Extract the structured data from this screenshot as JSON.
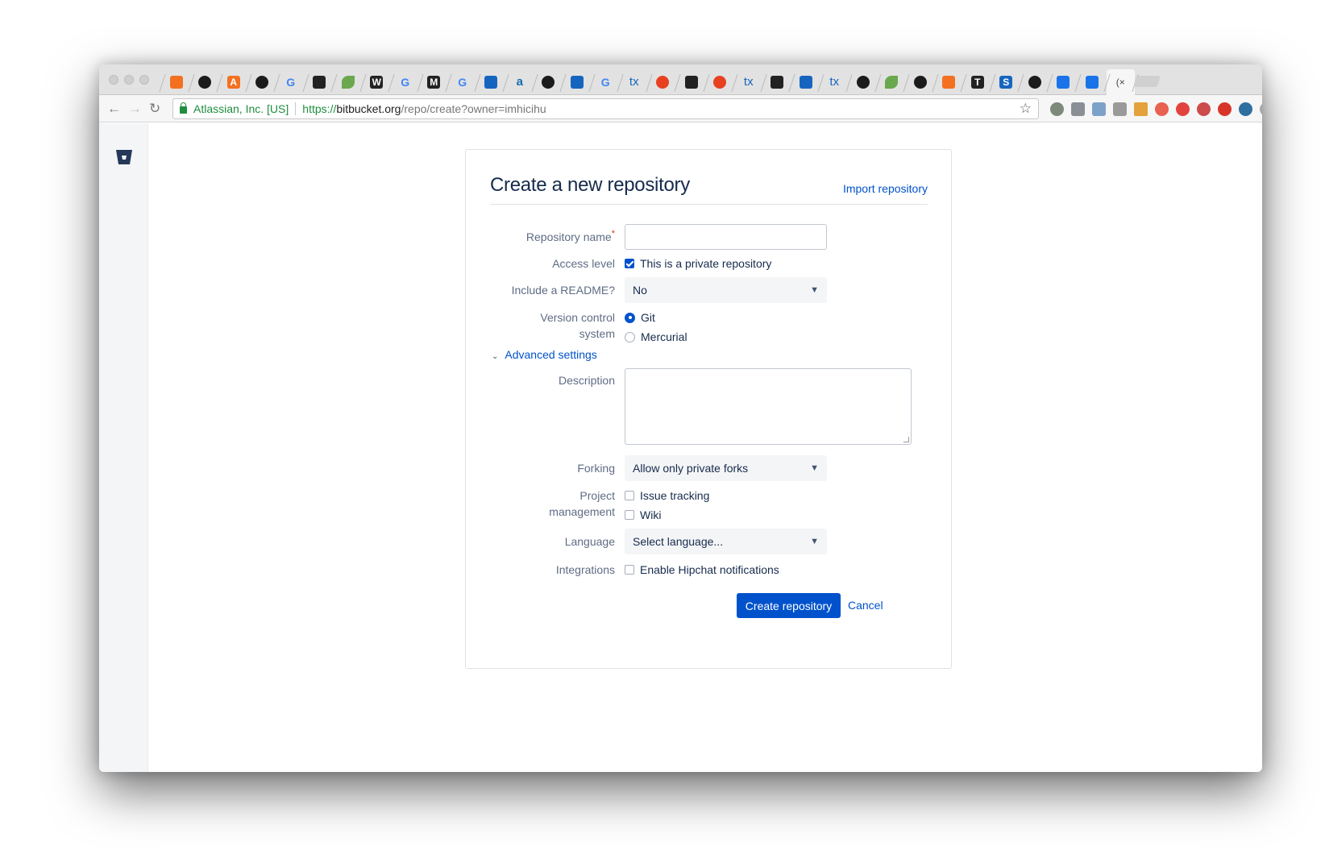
{
  "browser": {
    "tab_favicons": [
      "html5-icon",
      "github-icon",
      "a-icon",
      "github-icon",
      "google-icon",
      "book-icon",
      "leaf-icon",
      "w-icon",
      "google-icon",
      "medium-icon",
      "google-icon",
      "blue-square-icon",
      "amazon-icon",
      "github-icon",
      "cluster-icon",
      "google-icon",
      "tx-icon",
      "target-icon",
      "chip-icon",
      "target-icon",
      "tx-icon",
      "circle-icon",
      "grid-icon",
      "tx-icon",
      "github-icon",
      "layers-icon",
      "github-icon",
      "diamond-icon",
      "t-icon",
      "s-icon",
      "github-icon",
      "bitbucket-icon",
      "bitbucket-icon",
      "active-tab-icon",
      "speaker-icon"
    ],
    "tab_labels": [
      "",
      "",
      "A",
      "",
      "G",
      "",
      "",
      "W",
      "G",
      "M",
      "G",
      "",
      "a",
      "",
      "",
      "G",
      "tx",
      "",
      "",
      "",
      "tx",
      "",
      "",
      "tx",
      "",
      "",
      "",
      "",
      "T",
      "S",
      "",
      "",
      "",
      "(×",
      ".◀"
    ],
    "cert_label": "Atlassian, Inc. [US]",
    "url_scheme": "https://",
    "url_host": "bitbucket.org",
    "url_path": "/repo/create?owner=imhicihu"
  },
  "form": {
    "title": "Create a new repository",
    "import_link": "Import repository",
    "repo_name_label": "Repository name",
    "required_mark": "*",
    "repo_name_value": "",
    "access_label": "Access level",
    "private_option": "This is a private repository",
    "private_checked": true,
    "readme_label": "Include a README?",
    "readme_value": "No",
    "vcs_label_line1": "Version control",
    "vcs_label_line2": "system",
    "vcs_git": "Git",
    "vcs_mercurial": "Mercurial",
    "advanced_label": "Advanced settings",
    "description_label": "Description",
    "description_value": "",
    "forking_label": "Forking",
    "forking_value": "Allow only private forks",
    "pm_label_line1": "Project",
    "pm_label_line2": "management",
    "issue_tracking": "Issue tracking",
    "wiki": "Wiki",
    "language_label": "Language",
    "language_value": "Select language...",
    "integrations_label": "Integrations",
    "hipchat": "Enable Hipchat notifications",
    "create_button": "Create repository",
    "cancel_button": "Cancel"
  },
  "colors": {
    "primary": "#0052cc",
    "text": "#172b4d",
    "label": "#5e6c84",
    "secure_green": "#1e8e3e"
  }
}
